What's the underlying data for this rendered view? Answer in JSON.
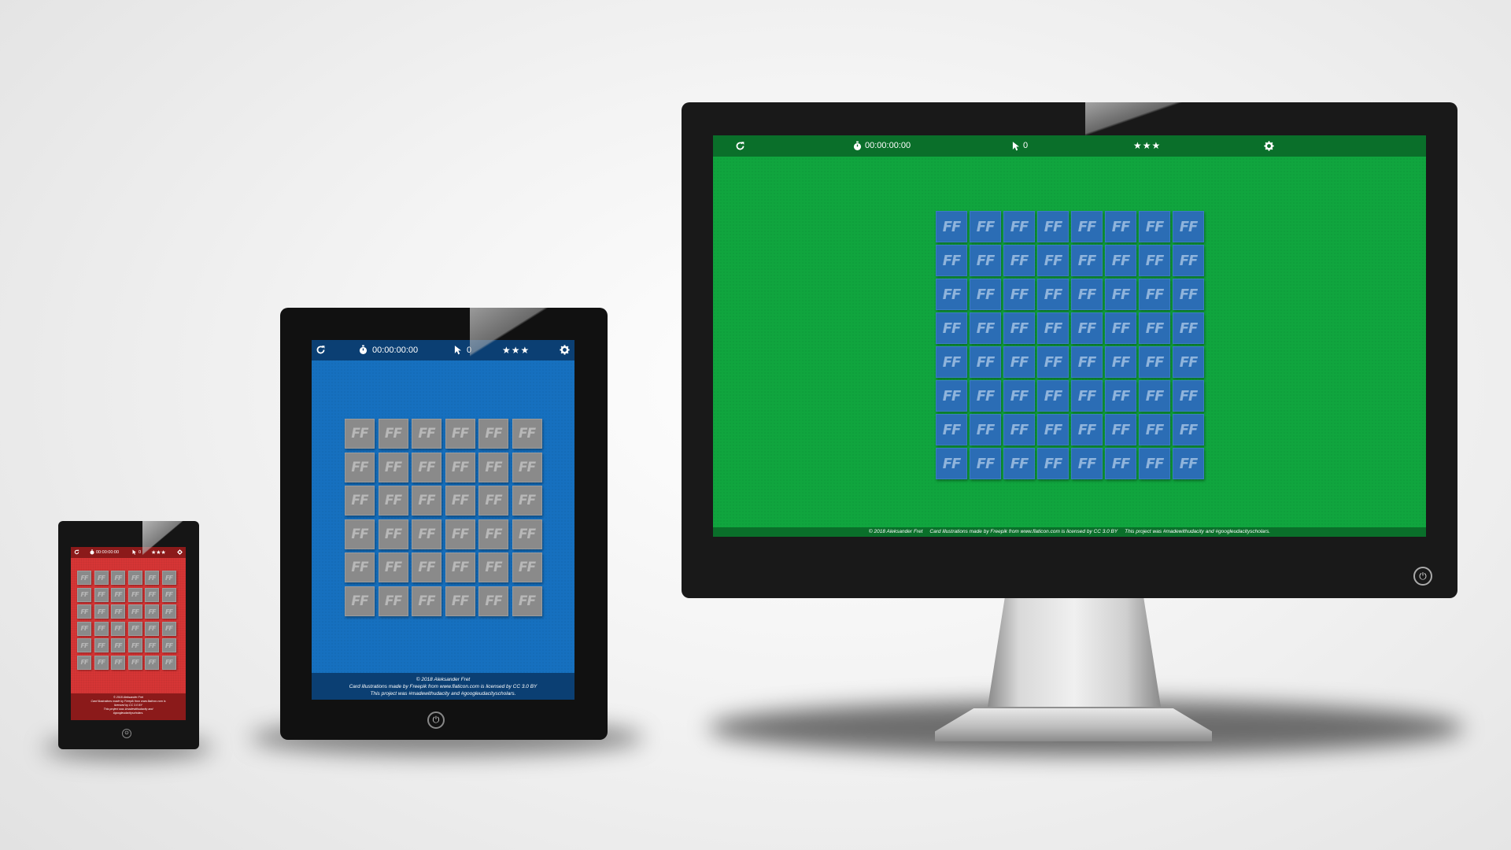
{
  "game": {
    "timer": "00:00:00:00",
    "moves": "0",
    "stars": "★★★",
    "card_face": "FF"
  },
  "footer": {
    "copyright": "© 2018 Aleksander Fret",
    "credits": "Card illustrations made by Freepik from www.flaticon.com is licensed by CC 3.0 BY",
    "credits_phone_a": "Card illustrations made by Freepik from www.flaticon.com is",
    "credits_phone_b": "licensed by CC 3.0 BY",
    "project": "This project was #madewithudacity and #googleudacityscholars.",
    "project_tablet": "This project was #madewithudacity and #googleudacityscholars.",
    "project_phone_a": "This project was #madewithudacity and",
    "project_phone_b": "#googleudacityscholars."
  },
  "devices": {
    "monitor": {
      "theme": "green",
      "grid": "8x8",
      "background": "#10a53e",
      "bar": "#0a6f2a",
      "card": "#2b6db5"
    },
    "tablet": {
      "theme": "blue",
      "grid": "6x6",
      "background": "#1670bf",
      "bar": "#0b3f73",
      "card": "#8a8a8a"
    },
    "phone": {
      "theme": "red",
      "grid": "6x6",
      "background": "#d63535",
      "bar": "#8b1a1a",
      "card": "#8a8a8a"
    }
  },
  "icons": {
    "restart": "refresh-icon",
    "timer": "stopwatch-icon",
    "moves": "pointer-icon",
    "settings": "gear-icon",
    "power": "power-icon"
  }
}
